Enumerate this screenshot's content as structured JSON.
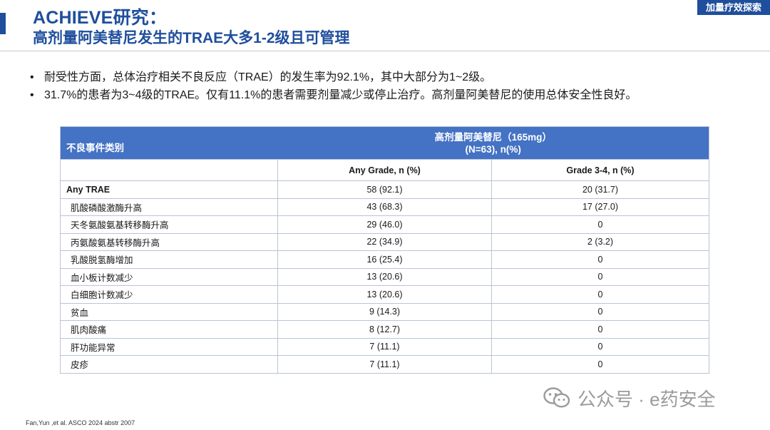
{
  "header": {
    "title": "ACHIEVE研究：",
    "subtitle": "高剂量阿美替尼发生的TRAE大多1-2级且可管理",
    "tag": "加量疗效探索"
  },
  "bullets": [
    "耐受性方面，总体治疗相关不良反应（TRAE）的发生率为92.1%，其中大部分为1~2级。",
    "31.7%的患者为3~4级的TRAE。仅有11.1%的患者需要剂量减少或停止治疗。高剂量阿美替尼的使用总体安全性良好。"
  ],
  "table": {
    "category_header": "不良事件类别",
    "drug_header_line1": "高剂量阿美替尼（165mg）",
    "drug_header_line2": "(N=63), n(%)",
    "col_any": "Any Grade, n (%)",
    "col_grade34": "Grade 3-4, n (%)",
    "rows": [
      {
        "name": "Any TRAE",
        "any": "58 (92.1)",
        "g34": "20 (31.7)"
      },
      {
        "name": "肌酸磷酸激酶升高",
        "any": "43 (68.3)",
        "g34": "17 (27.0)"
      },
      {
        "name": "天冬氨酸氨基转移酶升高",
        "any": "29 (46.0)",
        "g34": "0"
      },
      {
        "name": "丙氨酸氨基转移酶升高",
        "any": "22 (34.9)",
        "g34": "2 (3.2)"
      },
      {
        "name": "乳酸脱氢酶增加",
        "any": "16 (25.4)",
        "g34": "0"
      },
      {
        "name": "血小板计数减少",
        "any": "13 (20.6)",
        "g34": "0"
      },
      {
        "name": "白细胞计数减少",
        "any": "13 (20.6)",
        "g34": "0"
      },
      {
        "name": "贫血",
        "any": "9 (14.3)",
        "g34": "0"
      },
      {
        "name": "肌肉酸痛",
        "any": "8 (12.7)",
        "g34": "0"
      },
      {
        "name": "肝功能异常",
        "any": "7 (11.1)",
        "g34": "0"
      },
      {
        "name": "皮疹",
        "any": "7 (11.1)",
        "g34": "0"
      }
    ]
  },
  "footnote": "Fan,Yun ,et al. ASCO 2024  abstr 2007",
  "watermark": {
    "text": "公众号 · e药安全",
    "icon": "wechat-icon"
  },
  "colors": {
    "brand_blue": "#1f4e9c",
    "table_header_blue": "#4472c4"
  }
}
